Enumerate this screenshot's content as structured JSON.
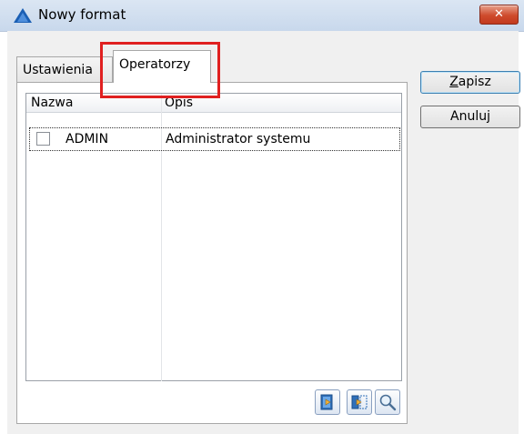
{
  "window": {
    "title": "Nowy format",
    "close_label": "✕"
  },
  "tabs": [
    {
      "label": "Ustawienia"
    },
    {
      "label": "Operatorzy"
    }
  ],
  "grid": {
    "columns": [
      "Nazwa",
      "Opis"
    ],
    "rows": [
      {
        "checked": false,
        "name": "ADMIN",
        "opis": "Administrator systemu"
      }
    ]
  },
  "buttons": {
    "save": "Zapisz",
    "cancel": "Anuluj"
  },
  "tools": [
    "add-operator-icon",
    "attach-operator-icon",
    "search-icon"
  ]
}
